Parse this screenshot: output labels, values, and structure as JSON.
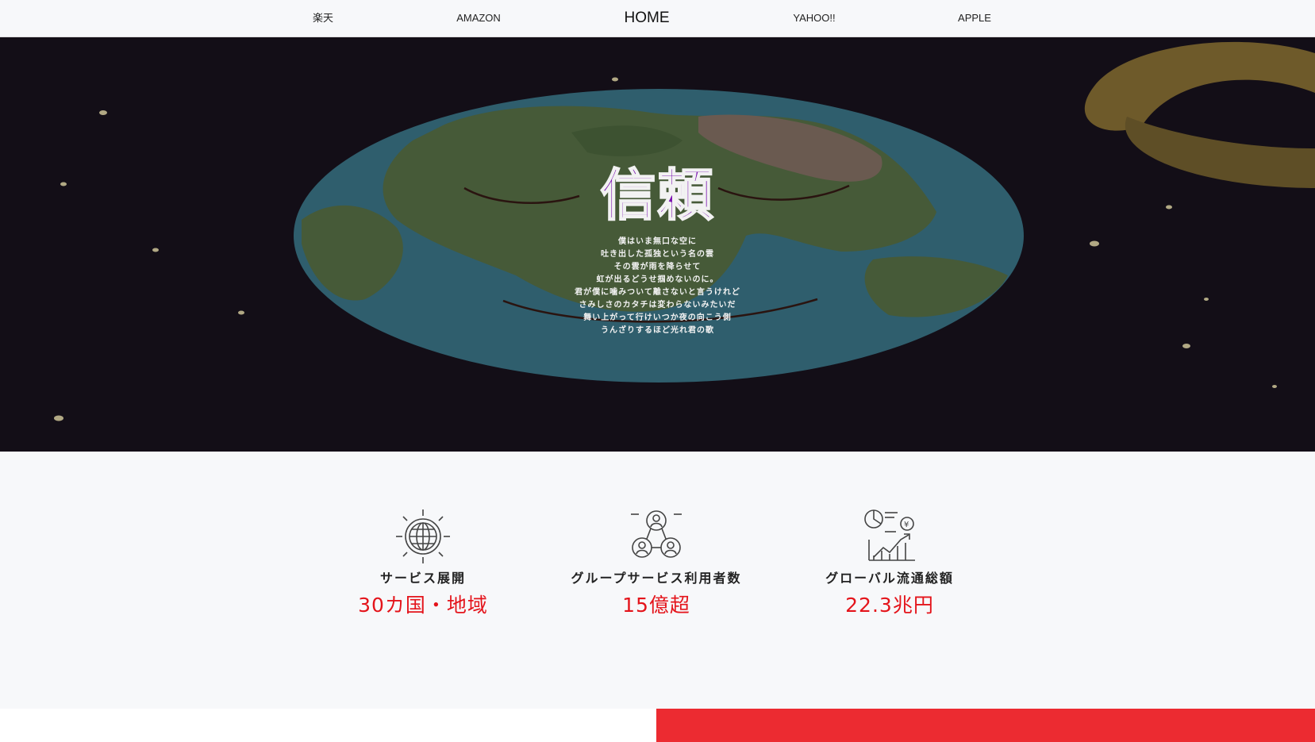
{
  "nav": {
    "items": [
      {
        "label": "楽天",
        "key": "rakuten"
      },
      {
        "label": "AMAZON",
        "key": "amazon"
      },
      {
        "label": "HOME",
        "key": "home"
      },
      {
        "label": "YAHOO!!",
        "key": "yahoo"
      },
      {
        "label": "APPLE",
        "key": "apple"
      }
    ]
  },
  "hero": {
    "title": "信頼",
    "poem": [
      "僕はいま無口な空に",
      "吐き出した孤独という名の雲",
      "その雲が雨を降らせて",
      "虹が出るどうせ掴めないのに。",
      "君が僕に噛みついて離さないと言うけれど",
      "さみしさのカタチは変わらないみたいだ",
      "舞い上がって行けいつか夜の向こう側",
      "うんざりするほど光れ君の歌"
    ]
  },
  "stats": [
    {
      "icon": "globe-icon",
      "label": "サービス展開",
      "value": "30カ国・地域"
    },
    {
      "icon": "users-network-icon",
      "label": "グループサービス利用者数",
      "value": "15億超"
    },
    {
      "icon": "growth-chart-icon",
      "label": "グローバル流通総額",
      "value": "22.3兆円"
    }
  ],
  "colors": {
    "accent_red": "#e4141b",
    "band_red": "#ec2b31",
    "title_purple": "#7a12b0",
    "hero_bg": "#130e17"
  }
}
